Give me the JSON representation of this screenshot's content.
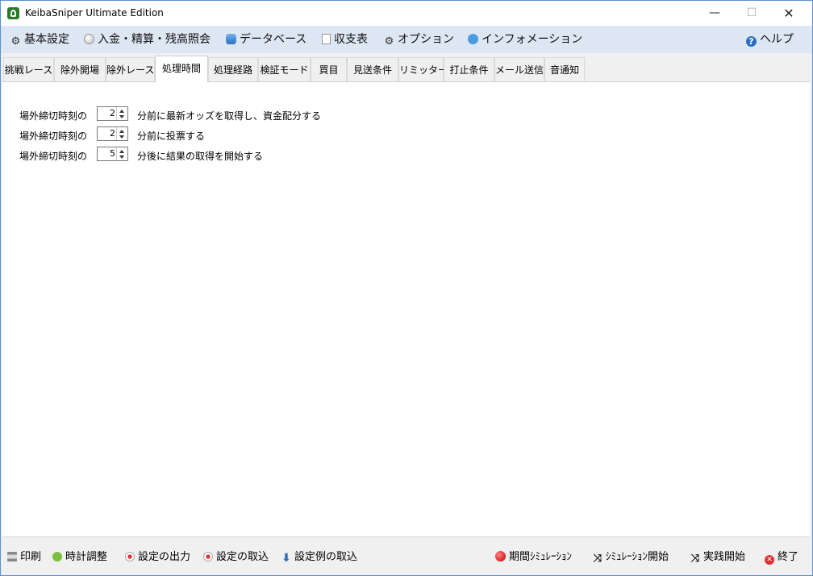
{
  "window": {
    "title": "KeibaSniper Ultimate Edition",
    "controls": {
      "minimize": "—",
      "maximize": "☐",
      "close": "✕"
    }
  },
  "menu": {
    "items": [
      {
        "label": "基本設定",
        "icon": "gear-icon"
      },
      {
        "label": "入金・精算・残高照会",
        "icon": "coin-icon"
      },
      {
        "label": "データベース",
        "icon": "database-icon"
      },
      {
        "label": "収支表",
        "icon": "document-icon"
      },
      {
        "label": "オプション",
        "icon": "gear-icon"
      },
      {
        "label": "インフォメーション",
        "icon": "chat-icon"
      }
    ],
    "help": {
      "label": "ヘルプ",
      "icon": "help-icon"
    }
  },
  "tabs": [
    {
      "label": "挑戦レース"
    },
    {
      "label": "除外開場"
    },
    {
      "label": "除外レース"
    },
    {
      "label": "処理時間",
      "active": true
    },
    {
      "label": "処理経路"
    },
    {
      "label": "検証モード"
    },
    {
      "label": "買目"
    },
    {
      "label": "見送条件"
    },
    {
      "label": "リミッター"
    },
    {
      "label": "打止条件"
    },
    {
      "label": "メール送信"
    },
    {
      "label": "音通知"
    }
  ],
  "settings": {
    "rows": [
      {
        "label": "場外締切時刻の",
        "value": "2",
        "suffix": "分前に最新オッズを取得し、資金配分する"
      },
      {
        "label": "場外締切時刻の",
        "value": "2",
        "suffix": "分前に投票する"
      },
      {
        "label": "場外締切時刻の",
        "value": "5",
        "suffix": "分後に結果の取得を開始する"
      }
    ]
  },
  "bottom": {
    "left": [
      {
        "label": "印刷",
        "icon": "printer-icon"
      },
      {
        "label": "時計調整",
        "icon": "clock-icon"
      },
      {
        "label": "設定の出力",
        "icon": "record-icon"
      },
      {
        "label": "設定の取込",
        "icon": "record-icon"
      },
      {
        "label": "設定例の取込",
        "icon": "down-arrow-icon"
      }
    ],
    "right": [
      {
        "label": "期間ｼﾐｭﾚｰｼｮﾝ",
        "icon": "red-ball-icon"
      },
      {
        "label": "ｼﾐｭﾚｰｼｮﾝ開始",
        "icon": "shuffle-icon"
      },
      {
        "label": "実践開始",
        "icon": "shuffle-icon"
      },
      {
        "label": "終了",
        "icon": "exit-icon"
      }
    ]
  }
}
